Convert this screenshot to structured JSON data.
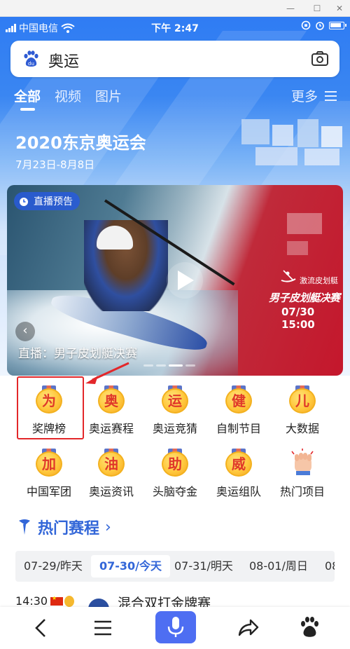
{
  "status_bar": {
    "carrier": "中国电信",
    "time": "下午 2:47"
  },
  "search": {
    "query": "奥运",
    "logo_icon": "baidu-paw-icon",
    "camera_icon": "camera-icon"
  },
  "tabs": [
    {
      "label": "全部",
      "active": true
    },
    {
      "label": "视频",
      "active": false
    },
    {
      "label": "图片",
      "active": false
    }
  ],
  "more_tab": "更多",
  "hero": {
    "title": "2020东京奥运会",
    "date_range": "7月23日-8月8日"
  },
  "video": {
    "badge": "直播预告",
    "caption": "直播：男子皮划艇决赛",
    "event_category": "激流皮划艇",
    "event_name": "男子皮划艇决赛",
    "event_time": "07/30 15:00"
  },
  "grid": [
    {
      "glyph": "为",
      "label": "奖牌榜"
    },
    {
      "glyph": "奥",
      "label": "奥运赛程"
    },
    {
      "glyph": "运",
      "label": "奥运竞猜"
    },
    {
      "glyph": "健",
      "label": "自制节目"
    },
    {
      "glyph": "儿",
      "label": "大数据"
    },
    {
      "glyph": "加",
      "label": "中国军团"
    },
    {
      "glyph": "油",
      "label": "奥运资讯"
    },
    {
      "glyph": "助",
      "label": "头脑夺金"
    },
    {
      "glyph": "威",
      "label": "奥运组队"
    },
    {
      "glyph": "",
      "label": "热门项目"
    }
  ],
  "hot_section": {
    "title": "热门赛程",
    "chevron": "›"
  },
  "dates": [
    {
      "label": "07-29/昨天",
      "active": false
    },
    {
      "label": "07-30/今天",
      "active": true
    },
    {
      "label": "07-31/明天",
      "active": false
    },
    {
      "label": "08-01/周日",
      "active": false
    },
    {
      "label": "08",
      "active": false
    }
  ],
  "match": {
    "time": "14:30",
    "name": "混合双打金牌赛"
  },
  "colors": {
    "accent_blue": "#3266d8",
    "highlight_red": "#e3272a",
    "mic_blue": "#4e6ef2"
  }
}
